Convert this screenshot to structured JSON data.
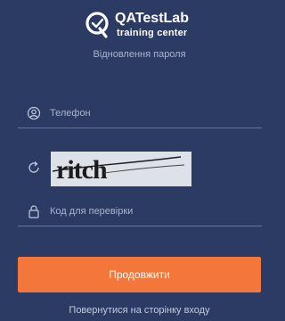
{
  "brand": {
    "name": "QATestLab",
    "tagline": "training center"
  },
  "page": {
    "subtitle": "Відновлення пароля"
  },
  "form": {
    "phone_placeholder": "Телефон",
    "captcha_text": "ritch",
    "code_placeholder": "Код для перевірки",
    "submit_label": "Продовжити"
  },
  "footer": {
    "back_link": "Повернутися на сторінку входу"
  },
  "colors": {
    "background": "#2b3b63",
    "accent": "#f3763a",
    "muted_text": "#a9b4cf"
  },
  "icons": {
    "logo": "qatestlab-logo-icon",
    "phone": "user-icon",
    "refresh": "refresh-icon",
    "code": "lock-icon"
  }
}
